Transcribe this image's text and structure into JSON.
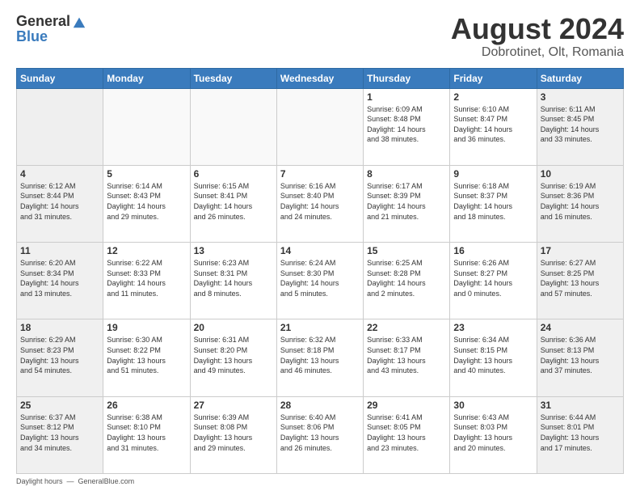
{
  "logo": {
    "general": "General",
    "blue": "Blue"
  },
  "title": "August 2024",
  "subtitle": "Dobrotinet, Olt, Romania",
  "days_header": [
    "Sunday",
    "Monday",
    "Tuesday",
    "Wednesday",
    "Thursday",
    "Friday",
    "Saturday"
  ],
  "weeks": [
    [
      {
        "day": "",
        "info": ""
      },
      {
        "day": "",
        "info": ""
      },
      {
        "day": "",
        "info": ""
      },
      {
        "day": "",
        "info": ""
      },
      {
        "day": "1",
        "info": "Sunrise: 6:09 AM\nSunset: 8:48 PM\nDaylight: 14 hours\nand 38 minutes."
      },
      {
        "day": "2",
        "info": "Sunrise: 6:10 AM\nSunset: 8:47 PM\nDaylight: 14 hours\nand 36 minutes."
      },
      {
        "day": "3",
        "info": "Sunrise: 6:11 AM\nSunset: 8:45 PM\nDaylight: 14 hours\nand 33 minutes."
      }
    ],
    [
      {
        "day": "4",
        "info": "Sunrise: 6:12 AM\nSunset: 8:44 PM\nDaylight: 14 hours\nand 31 minutes."
      },
      {
        "day": "5",
        "info": "Sunrise: 6:14 AM\nSunset: 8:43 PM\nDaylight: 14 hours\nand 29 minutes."
      },
      {
        "day": "6",
        "info": "Sunrise: 6:15 AM\nSunset: 8:41 PM\nDaylight: 14 hours\nand 26 minutes."
      },
      {
        "day": "7",
        "info": "Sunrise: 6:16 AM\nSunset: 8:40 PM\nDaylight: 14 hours\nand 24 minutes."
      },
      {
        "day": "8",
        "info": "Sunrise: 6:17 AM\nSunset: 8:39 PM\nDaylight: 14 hours\nand 21 minutes."
      },
      {
        "day": "9",
        "info": "Sunrise: 6:18 AM\nSunset: 8:37 PM\nDaylight: 14 hours\nand 18 minutes."
      },
      {
        "day": "10",
        "info": "Sunrise: 6:19 AM\nSunset: 8:36 PM\nDaylight: 14 hours\nand 16 minutes."
      }
    ],
    [
      {
        "day": "11",
        "info": "Sunrise: 6:20 AM\nSunset: 8:34 PM\nDaylight: 14 hours\nand 13 minutes."
      },
      {
        "day": "12",
        "info": "Sunrise: 6:22 AM\nSunset: 8:33 PM\nDaylight: 14 hours\nand 11 minutes."
      },
      {
        "day": "13",
        "info": "Sunrise: 6:23 AM\nSunset: 8:31 PM\nDaylight: 14 hours\nand 8 minutes."
      },
      {
        "day": "14",
        "info": "Sunrise: 6:24 AM\nSunset: 8:30 PM\nDaylight: 14 hours\nand 5 minutes."
      },
      {
        "day": "15",
        "info": "Sunrise: 6:25 AM\nSunset: 8:28 PM\nDaylight: 14 hours\nand 2 minutes."
      },
      {
        "day": "16",
        "info": "Sunrise: 6:26 AM\nSunset: 8:27 PM\nDaylight: 14 hours\nand 0 minutes."
      },
      {
        "day": "17",
        "info": "Sunrise: 6:27 AM\nSunset: 8:25 PM\nDaylight: 13 hours\nand 57 minutes."
      }
    ],
    [
      {
        "day": "18",
        "info": "Sunrise: 6:29 AM\nSunset: 8:23 PM\nDaylight: 13 hours\nand 54 minutes."
      },
      {
        "day": "19",
        "info": "Sunrise: 6:30 AM\nSunset: 8:22 PM\nDaylight: 13 hours\nand 51 minutes."
      },
      {
        "day": "20",
        "info": "Sunrise: 6:31 AM\nSunset: 8:20 PM\nDaylight: 13 hours\nand 49 minutes."
      },
      {
        "day": "21",
        "info": "Sunrise: 6:32 AM\nSunset: 8:18 PM\nDaylight: 13 hours\nand 46 minutes."
      },
      {
        "day": "22",
        "info": "Sunrise: 6:33 AM\nSunset: 8:17 PM\nDaylight: 13 hours\nand 43 minutes."
      },
      {
        "day": "23",
        "info": "Sunrise: 6:34 AM\nSunset: 8:15 PM\nDaylight: 13 hours\nand 40 minutes."
      },
      {
        "day": "24",
        "info": "Sunrise: 6:36 AM\nSunset: 8:13 PM\nDaylight: 13 hours\nand 37 minutes."
      }
    ],
    [
      {
        "day": "25",
        "info": "Sunrise: 6:37 AM\nSunset: 8:12 PM\nDaylight: 13 hours\nand 34 minutes."
      },
      {
        "day": "26",
        "info": "Sunrise: 6:38 AM\nSunset: 8:10 PM\nDaylight: 13 hours\nand 31 minutes."
      },
      {
        "day": "27",
        "info": "Sunrise: 6:39 AM\nSunset: 8:08 PM\nDaylight: 13 hours\nand 29 minutes."
      },
      {
        "day": "28",
        "info": "Sunrise: 6:40 AM\nSunset: 8:06 PM\nDaylight: 13 hours\nand 26 minutes."
      },
      {
        "day": "29",
        "info": "Sunrise: 6:41 AM\nSunset: 8:05 PM\nDaylight: 13 hours\nand 23 minutes."
      },
      {
        "day": "30",
        "info": "Sunrise: 6:43 AM\nSunset: 8:03 PM\nDaylight: 13 hours\nand 20 minutes."
      },
      {
        "day": "31",
        "info": "Sunrise: 6:44 AM\nSunset: 8:01 PM\nDaylight: 13 hours\nand 17 minutes."
      }
    ]
  ],
  "footer": {
    "daylight_label": "Daylight hours",
    "source": "GeneralBlue.com"
  }
}
